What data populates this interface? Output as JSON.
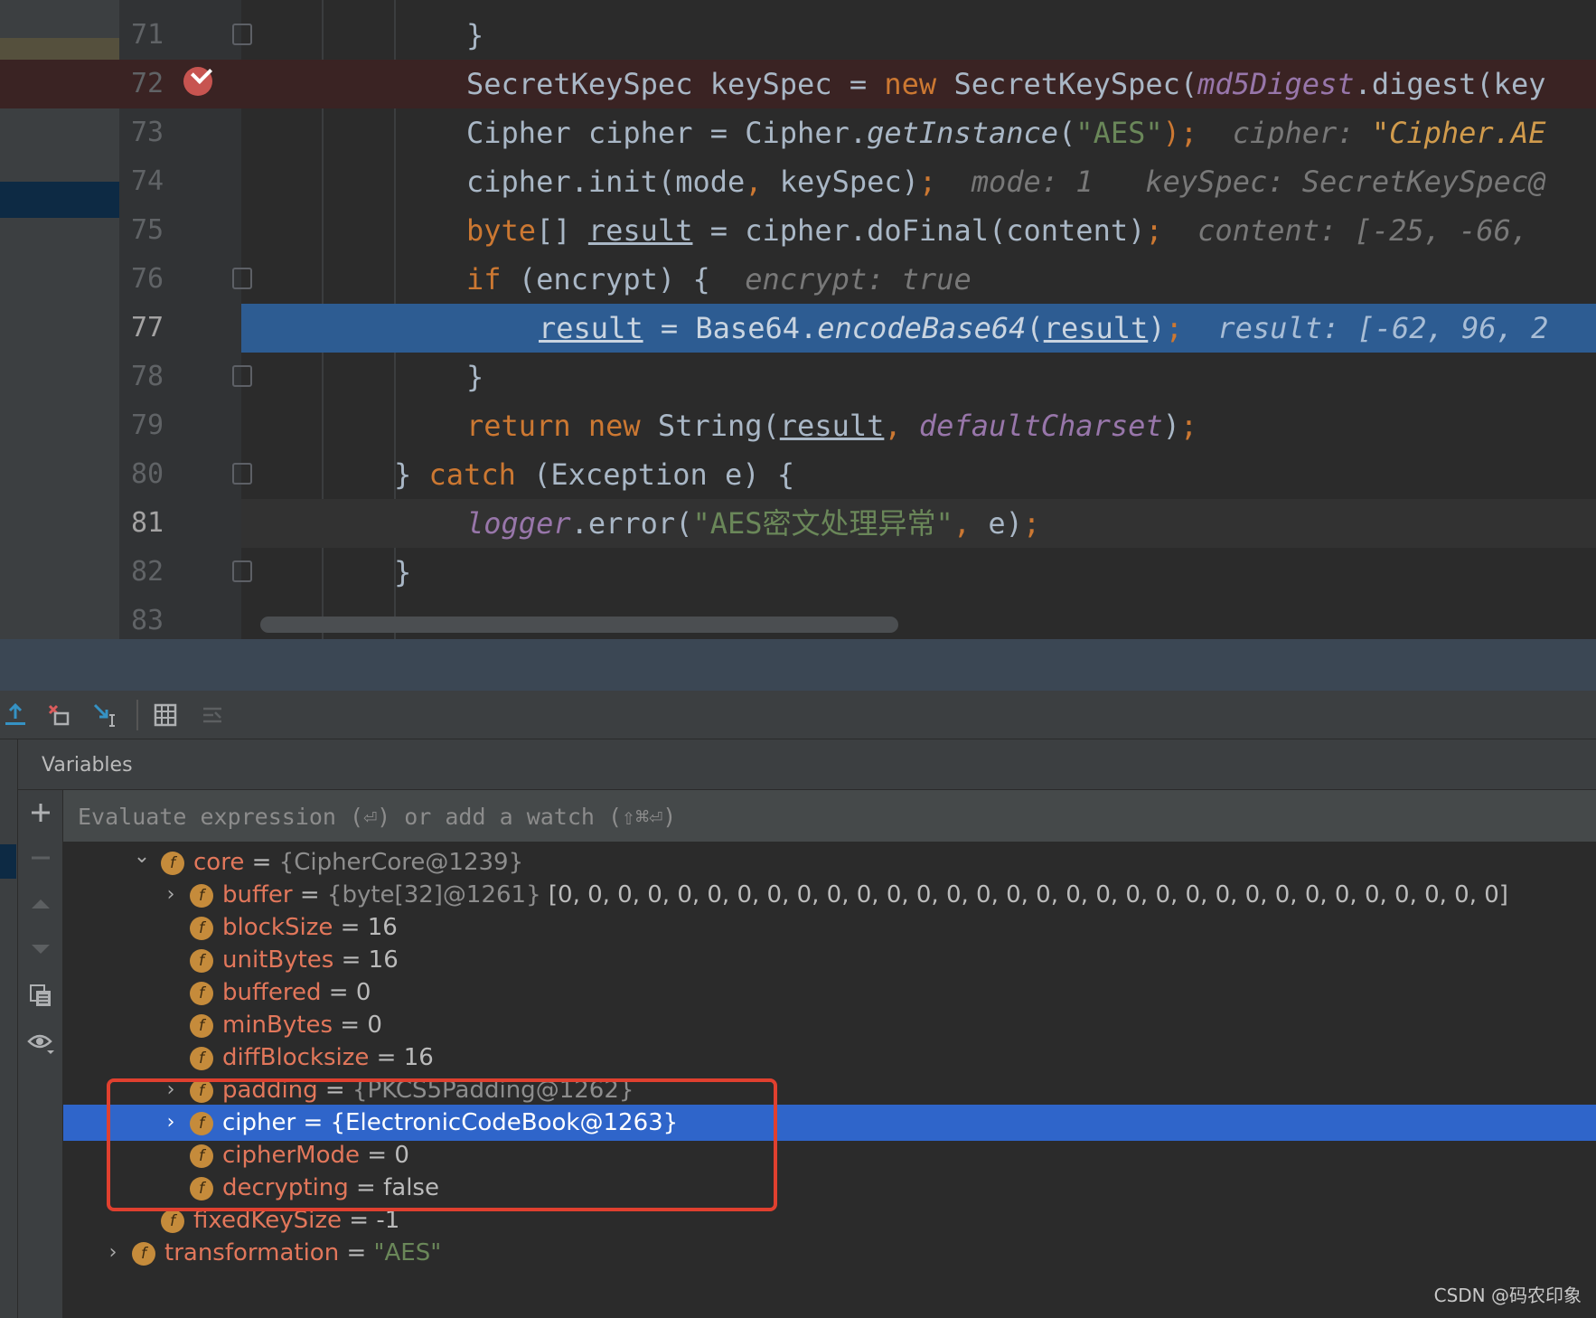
{
  "editor": {
    "lines": [
      {
        "num": "71",
        "tokens": [
          {
            "t": "}",
            "c": "plain"
          }
        ]
      },
      {
        "num": "72",
        "tokens": [
          {
            "t": "SecretKeySpec keySpec = ",
            "c": "plain"
          },
          {
            "t": "new",
            "c": "kw"
          },
          {
            "t": " SecretKeySpec(",
            "c": "plain"
          },
          {
            "t": "md5Digest",
            "c": "fld"
          },
          {
            "t": ".digest(key",
            "c": "plain"
          }
        ]
      },
      {
        "num": "73",
        "tokens": [
          {
            "t": "Cipher cipher = Cipher.",
            "c": "plain"
          },
          {
            "t": "getInstance",
            "c": "it"
          },
          {
            "t": "(",
            "c": "plain"
          },
          {
            "t": "\"AES\"",
            "c": "str"
          },
          {
            "t": ");",
            "c": "kw"
          },
          {
            "t": "  cipher: ",
            "c": "hint"
          },
          {
            "t": "\"Cipher.AE",
            "c": "hintv"
          }
        ]
      },
      {
        "num": "74",
        "tokens": [
          {
            "t": "cipher.init(mode",
            "c": "plain"
          },
          {
            "t": ",",
            "c": "kw"
          },
          {
            "t": " keySpec)",
            "c": "plain"
          },
          {
            "t": ";",
            "c": "kw"
          },
          {
            "t": "  mode: 1   keySpec: SecretKeySpec@",
            "c": "hint"
          }
        ]
      },
      {
        "num": "75",
        "tokens": [
          {
            "t": "byte",
            "c": "kw"
          },
          {
            "t": "[] ",
            "c": "plain"
          },
          {
            "t": "result",
            "c": "ul"
          },
          {
            "t": " = cipher.doFinal(content)",
            "c": "plain"
          },
          {
            "t": ";",
            "c": "kw"
          },
          {
            "t": "  content: [-25, -66,",
            "c": "hint"
          }
        ]
      },
      {
        "num": "76",
        "tokens": [
          {
            "t": "if",
            "c": "kw"
          },
          {
            "t": " (encrypt) {",
            "c": "plain"
          },
          {
            "t": "  encrypt: true",
            "c": "hint"
          }
        ]
      },
      {
        "num": "77",
        "tokens": [
          {
            "t": "result",
            "c": "ul"
          },
          {
            "t": " = Base64.",
            "c": "plain"
          },
          {
            "t": "encodeBase64",
            "c": "it"
          },
          {
            "t": "(",
            "c": "plain"
          },
          {
            "t": "result",
            "c": "ul"
          },
          {
            "t": ")",
            "c": "plain"
          },
          {
            "t": ";",
            "c": "kw"
          },
          {
            "t": "  result: [-62, 96, 2",
            "c": "hint"
          }
        ]
      },
      {
        "num": "78",
        "tokens": [
          {
            "t": "}",
            "c": "plain"
          }
        ]
      },
      {
        "num": "79",
        "tokens": [
          {
            "t": "return new",
            "c": "kw"
          },
          {
            "t": " String(",
            "c": "plain"
          },
          {
            "t": "result",
            "c": "ul"
          },
          {
            "t": ",",
            "c": "kw"
          },
          {
            "t": " ",
            "c": "plain"
          },
          {
            "t": "defaultCharset",
            "c": "fld"
          },
          {
            "t": ")",
            "c": "plain"
          },
          {
            "t": ";",
            "c": "kw"
          }
        ]
      },
      {
        "num": "80",
        "tokens": [
          {
            "t": "} ",
            "c": "plain"
          },
          {
            "t": "catch",
            "c": "kw"
          },
          {
            "t": " (Exception e) {",
            "c": "plain"
          }
        ]
      },
      {
        "num": "81",
        "tokens": [
          {
            "t": "logger",
            "c": "fld"
          },
          {
            "t": ".error(",
            "c": "plain"
          },
          {
            "t": "\"AES密文处理异常\"",
            "c": "str"
          },
          {
            "t": ",",
            "c": "kw"
          },
          {
            "t": " e)",
            "c": "plain"
          },
          {
            "t": ";",
            "c": "kw"
          }
        ]
      },
      {
        "num": "82",
        "tokens": [
          {
            "t": "}",
            "c": "plain"
          }
        ]
      },
      {
        "num": "83",
        "tokens": []
      }
    ]
  },
  "debug_toolbar": {
    "buttons": [
      "step-out-icon",
      "drop-frame-icon",
      "run-to-cursor-icon",
      "evaluate-table-icon",
      "trace-icon"
    ]
  },
  "variables": {
    "title": "Variables",
    "eval_placeholder": "Evaluate expression (⏎) or add a watch (⇧⌘⏎)",
    "rows": [
      {
        "name": "core",
        "eq": " = ",
        "type": "{CipherCore@1239}",
        "value": "",
        "expanded": true
      },
      {
        "name": "buffer",
        "eq": " = ",
        "type": "{byte[32]@1261} ",
        "value": "[0, 0, 0, 0, 0, 0, 0, 0, 0, 0, 0, 0, 0, 0, 0, 0, 0, 0, 0, 0, 0, 0, 0, 0, 0, 0, 0, 0, 0, 0, 0, 0]",
        "expanded": false
      },
      {
        "name": "blockSize",
        "eq": " = ",
        "type": "",
        "value": "16"
      },
      {
        "name": "unitBytes",
        "eq": " = ",
        "type": "",
        "value": "16"
      },
      {
        "name": "buffered",
        "eq": " = ",
        "type": "",
        "value": "0"
      },
      {
        "name": "minBytes",
        "eq": " = ",
        "type": "",
        "value": "0"
      },
      {
        "name": "diffBlocksize",
        "eq": " = ",
        "type": "",
        "value": "16"
      },
      {
        "name": "padding",
        "eq": " = ",
        "type": "{PKCS5Padding@1262}",
        "value": "",
        "expanded": false
      },
      {
        "name": "cipher",
        "eq": " = ",
        "type": "{ElectronicCodeBook@1263}",
        "value": "",
        "expanded": false,
        "selected": true
      },
      {
        "name": "cipherMode",
        "eq": " = ",
        "type": "",
        "value": "0"
      },
      {
        "name": "decrypting",
        "eq": " = ",
        "type": "",
        "value": "false"
      },
      {
        "name": "fixedKeySize",
        "eq": " = ",
        "type": "",
        "value": "-1"
      },
      {
        "name": "transformation",
        "eq": " = ",
        "type": "",
        "value": "\"AES\"",
        "expanded": false
      }
    ]
  },
  "field_icon_letter": "f",
  "watermark": "CSDN @码农印象",
  "colors": {
    "accent_selection": "#2f65ca",
    "field_name": "#e2775b",
    "annotation_box": "#e0402f",
    "execution_line": "#2d5c92"
  }
}
